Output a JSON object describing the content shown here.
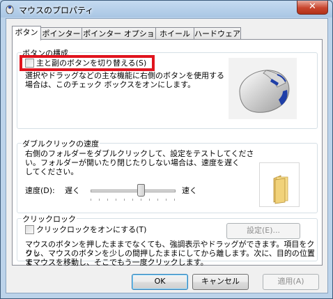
{
  "window": {
    "title": "マウスのプロパティ",
    "close_glyph": "✕"
  },
  "tabs": [
    {
      "label": "ボタン",
      "active": true
    },
    {
      "label": "ポインター"
    },
    {
      "label": "ポインター オプション"
    },
    {
      "label": "ホイール"
    },
    {
      "label": "ハードウェア"
    }
  ],
  "button_config": {
    "title": "ボタンの構成",
    "swap_checkbox_label": "主と副のボタンを切り替える(S)",
    "swap_checked": false,
    "description_line1": "選択やドラッグなどの主な機能に右側のボタンを使用する",
    "description_line2": "場合は、このチェック ボックスをオンにします。"
  },
  "double_click": {
    "title": "ダブルクリックの速度",
    "description_line1": "右側のフォルダーをダブルクリックして、設定をテストしてくださ",
    "description_line2": "い。フォルダーが開いたり閉じたりしない場合は、速度を遅く",
    "description_line3": "してください。",
    "speed_label": "速度(D):",
    "slow_label": "遅く",
    "fast_label": "速く",
    "speed_value": 0.6
  },
  "click_lock": {
    "title": "クリックロック",
    "checkbox_label": "クリックロックをオンにする(T)",
    "checked": false,
    "settings_button": "設定(E)...",
    "description_line1": "マウスのボタンを押したままでなくても、強調表示やドラッグができます。項目をクリッ",
    "description_line2": "クし、マウスのボタンを少しの間押したままにしてから離します。次に、目的の位置ま",
    "description_line3": "でマウスを移動し、そこでもう一度クリックします。"
  },
  "footer": {
    "ok": "OK",
    "cancel": "キャンセル",
    "apply": "適用(A)"
  },
  "colors": {
    "highlight_border": "#e0141e",
    "mouse_accent": "#1f3fa8"
  }
}
